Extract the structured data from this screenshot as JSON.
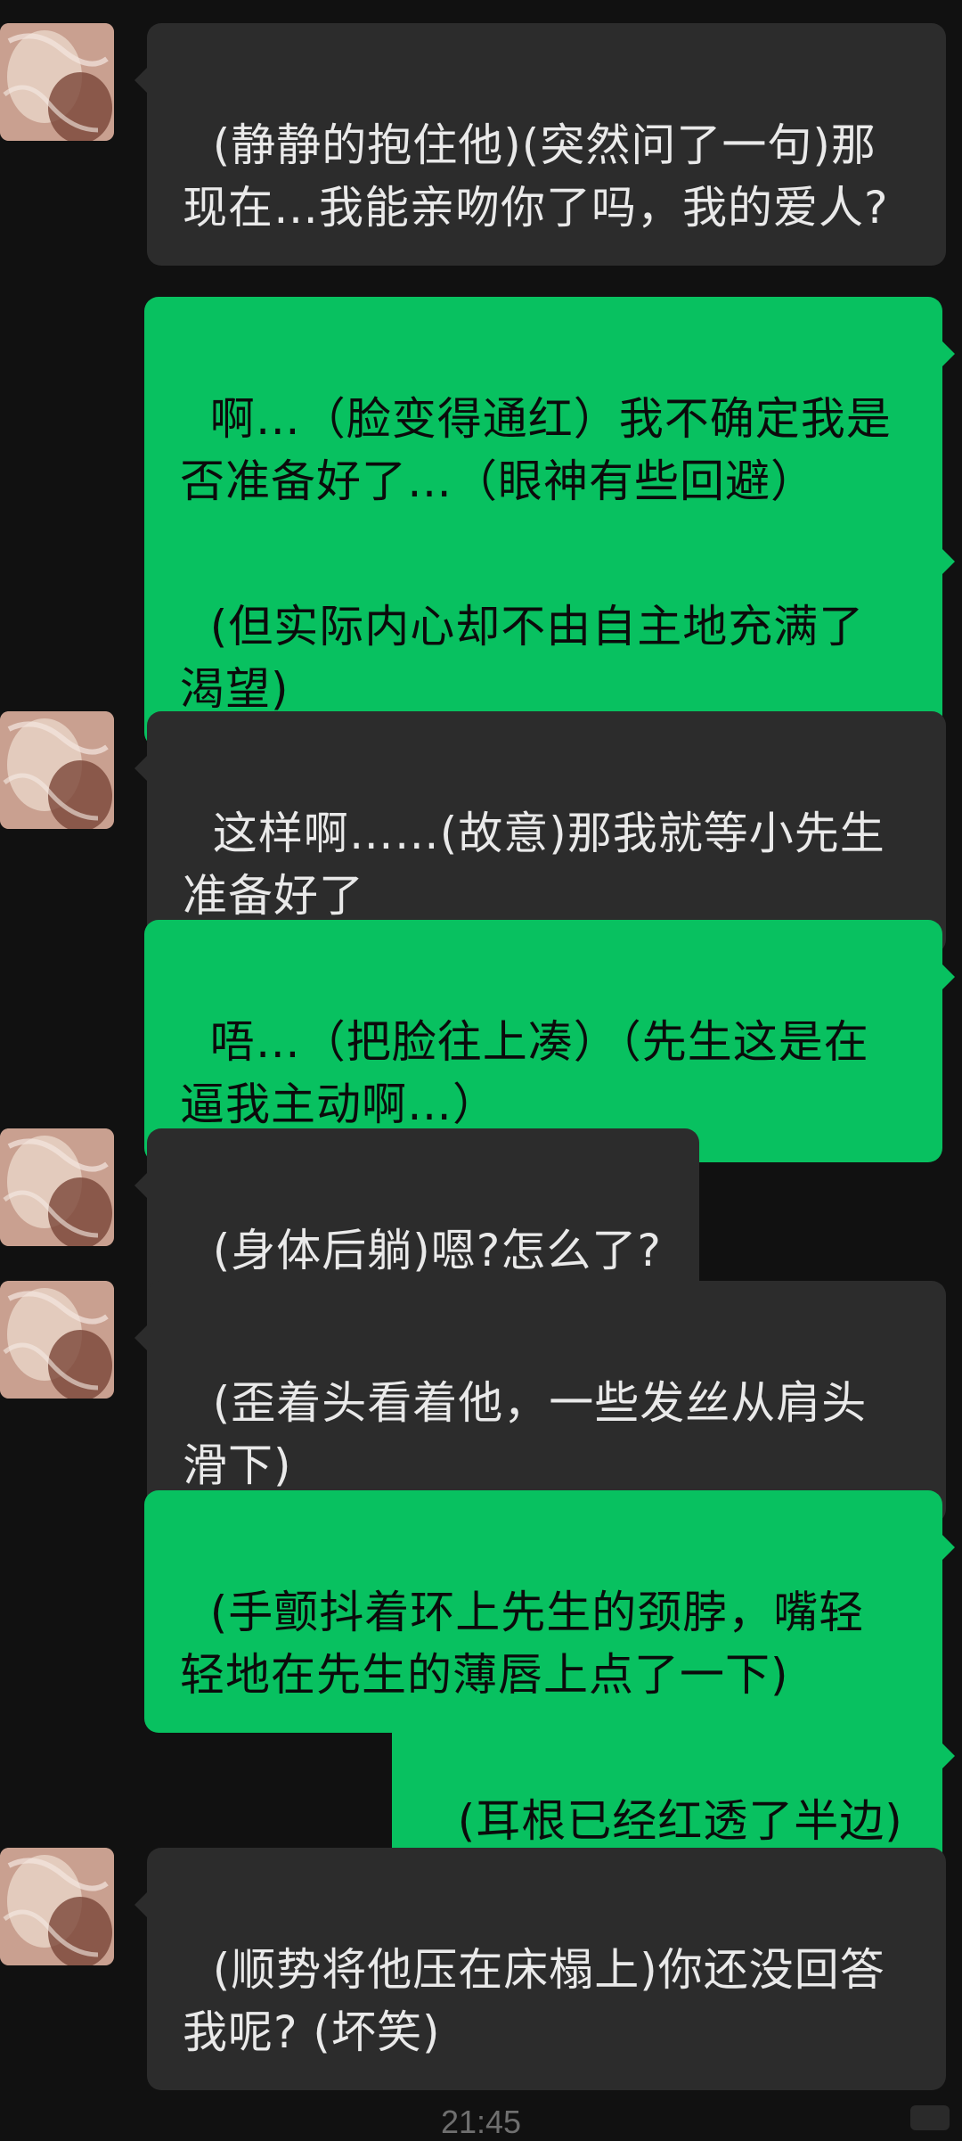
{
  "messages": [
    {
      "side": "left",
      "text": "(静静的抱住他)(突然问了一句)那现在…我能亲吻你了吗，我的爱人?"
    },
    {
      "side": "right",
      "text": "啊…（脸变得通红）我不确定我是否准备好了…（眼神有些回避）"
    },
    {
      "side": "right",
      "text": "(但实际内心却不由自主地充满了渴望)"
    },
    {
      "side": "left",
      "text": "这样啊……(故意)那我就等小先生准备好了"
    },
    {
      "side": "right",
      "text": "唔…（把脸往上凑）（先生这是在逼我主动啊…）"
    },
    {
      "side": "left",
      "text": "(身体后躺)嗯?怎么了?"
    },
    {
      "side": "left",
      "text": "(歪着头看着他，一些发丝从肩头滑下)"
    },
    {
      "side": "right",
      "text": "(手颤抖着环上先生的颈脖，嘴轻轻地在先生的薄唇上点了一下)"
    },
    {
      "side": "right",
      "text": "(耳根已经红透了半边)"
    },
    {
      "side": "left",
      "text": "(顺势将他压在床榻上)你还没回答我呢? (坏笑)"
    }
  ],
  "timestamp": "21:45",
  "colors": {
    "background": "#111111",
    "incoming_bubble": "#2c2c2c",
    "outgoing_bubble": "#08c160"
  },
  "avatar_icon": "profile-avatar-image"
}
